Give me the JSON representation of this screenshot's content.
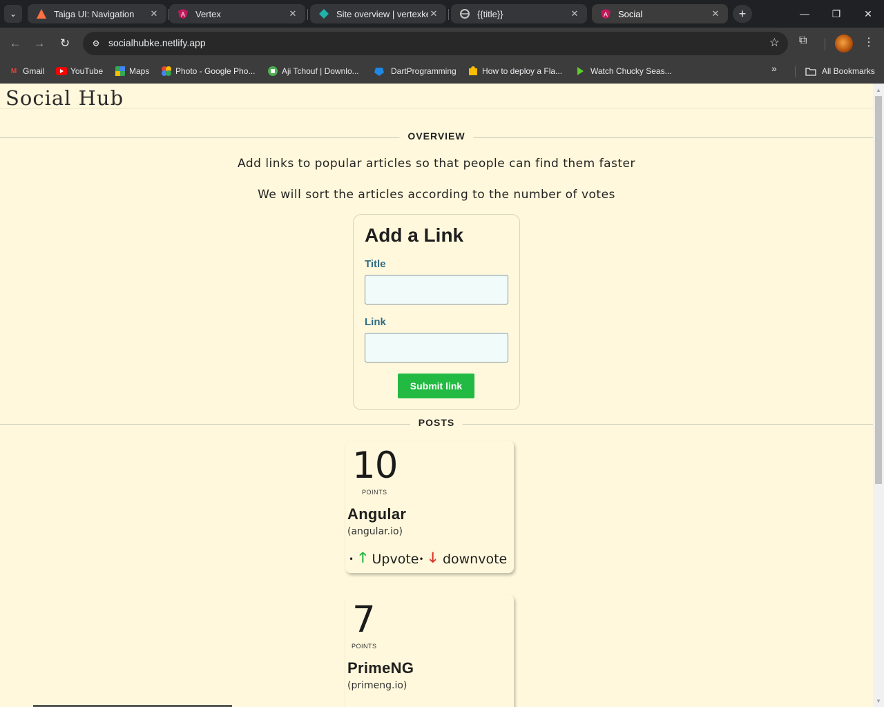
{
  "browser": {
    "tabs": [
      {
        "title": "Taiga UI: Navigation",
        "icon": "taiga-icon"
      },
      {
        "title": "Vertex",
        "icon": "angular-icon"
      },
      {
        "title": "Site overview | vertexke |",
        "icon": "netlify-icon"
      },
      {
        "title": "{{title}}",
        "icon": "globe-icon"
      },
      {
        "title": "Social",
        "icon": "angular-icon",
        "active": true
      }
    ],
    "url": "socialhubke.netlify.app",
    "bookmarks": [
      {
        "label": "Gmail",
        "icon": "gmail-icon"
      },
      {
        "label": "YouTube",
        "icon": "youtube-icon"
      },
      {
        "label": "Maps",
        "icon": "maps-icon"
      },
      {
        "label": "Photo - Google Pho...",
        "icon": "photos-icon"
      },
      {
        "label": "Aji Tchouf | Downlo...",
        "icon": "site-icon"
      },
      {
        "label": "DartProgramming",
        "icon": "dart-icon"
      },
      {
        "label": "How to deploy a Fla...",
        "icon": "folder-icon"
      },
      {
        "label": "Watch Chucky Seas...",
        "icon": "play-icon"
      }
    ],
    "all_bookmarks": "All Bookmarks"
  },
  "page": {
    "brand": "Social Hub",
    "overview_label": "OVERVIEW",
    "intro_line1": "Add links to popular articles so that people can find them faster",
    "intro_line2": "We will sort the articles according to the number of votes",
    "form": {
      "title": "Add a Link",
      "title_label": "Title",
      "title_value": "",
      "link_label": "Link",
      "link_value": "",
      "submit": "Submit link"
    },
    "posts_label": "POSTS",
    "posts": [
      {
        "points": "10",
        "points_label": "POINTS",
        "title": "Angular",
        "domain": "(angular.io)",
        "upvote": "Upvote",
        "downvote": "downvote"
      },
      {
        "points": "7",
        "points_label": "POINTS",
        "title": "PrimeNG",
        "domain": "(primeng.io)"
      }
    ]
  },
  "colors": {
    "page_bg": "#fff8dc",
    "accent_green": "#22ba42",
    "label_blue": "#2e6b86",
    "downvote_red": "#d93025"
  }
}
